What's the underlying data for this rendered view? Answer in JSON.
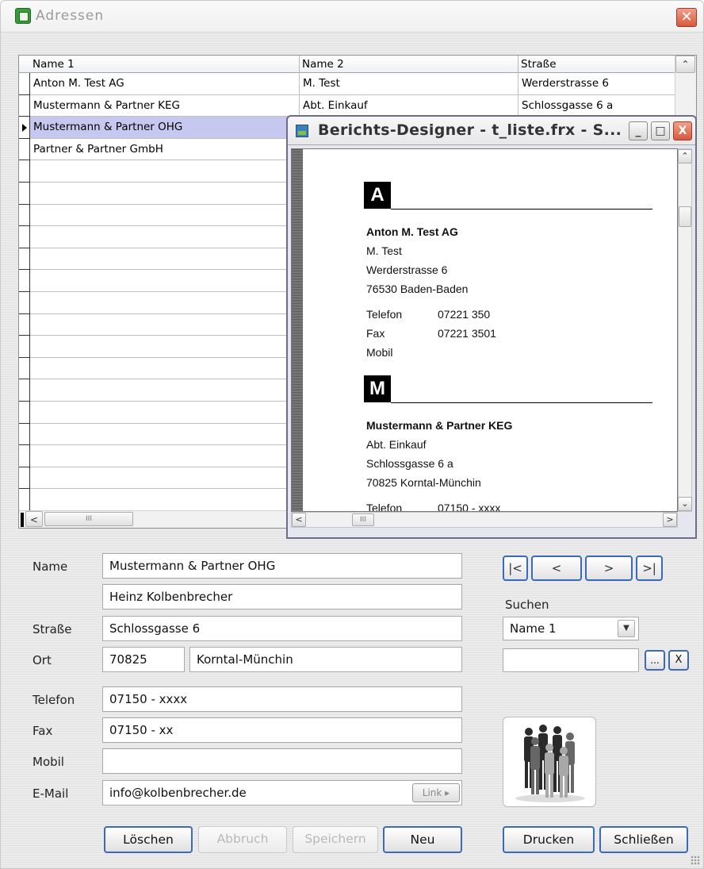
{
  "window": {
    "title": "Adressen"
  },
  "grid": {
    "columns": [
      "Name 1",
      "Name 2",
      "Straße"
    ],
    "rows": [
      [
        "Anton M. Test AG",
        "M. Test",
        "Werderstrasse 6"
      ],
      [
        "Mustermann & Partner KEG",
        "Abt. Einkauf",
        "Schlossgasse 6 a"
      ],
      [
        "Mustermann & Partner OHG",
        "",
        ""
      ],
      [
        "Partner & Partner GmbH",
        "",
        ""
      ]
    ],
    "selected_row": 2,
    "scroll_thumb_label": "III"
  },
  "report": {
    "title": "Berichts-Designer - t_liste.frx - S...",
    "min_label": "_",
    "max_label": "□",
    "close_label": "X",
    "section_a": {
      "letter": "A",
      "company": "Anton M. Test AG",
      "line2": "M. Test",
      "street": "Werderstrasse 6",
      "city": "76530 Baden-Baden",
      "tel_label": "Telefon",
      "tel_value": "07221 350",
      "fax_label": "Fax",
      "fax_value": "07221 3501",
      "mobil_label": "Mobil"
    },
    "section_m": {
      "letter": "M",
      "company": "Mustermann & Partner KEG",
      "line2": "Abt. Einkauf",
      "street": "Schlossgasse 6 a",
      "city": "70825 Korntal-Münchin",
      "tel_label": "Telefon",
      "tel_value": "07150 - xxxx"
    },
    "scroll_thumb_label": "III"
  },
  "form": {
    "name_label": "Name",
    "name1": "Mustermann & Partner OHG",
    "name2": "Heinz Kolbenbrecher",
    "strasse_label": "Straße",
    "strasse": "Schlossgasse 6",
    "ort_label": "Ort",
    "plz": "70825",
    "ort": "Korntal-Münchin",
    "telefon_label": "Telefon",
    "telefon": "07150 - xxxx",
    "fax_label": "Fax",
    "fax": "07150 - xx",
    "mobil_label": "Mobil",
    "mobil": "",
    "email_label": "E-Mail",
    "email": "info@kolbenbrecher.de",
    "link_label": "Link ▸"
  },
  "navigation": {
    "first": "|<",
    "prev": "<",
    "next": ">",
    "last": ">|"
  },
  "search": {
    "label": "Suchen",
    "field_selected": "Name 1",
    "value": "",
    "browse_label": "...",
    "clear_label": "X"
  },
  "buttons": {
    "loeschen": "Löschen",
    "abbruch": "Abbruch",
    "speichern": "Speichern",
    "neu": "Neu",
    "drucken": "Drucken",
    "schliessen": "Schließen"
  },
  "icons": {
    "app": "address-book-icon",
    "photo": "group-photo"
  }
}
